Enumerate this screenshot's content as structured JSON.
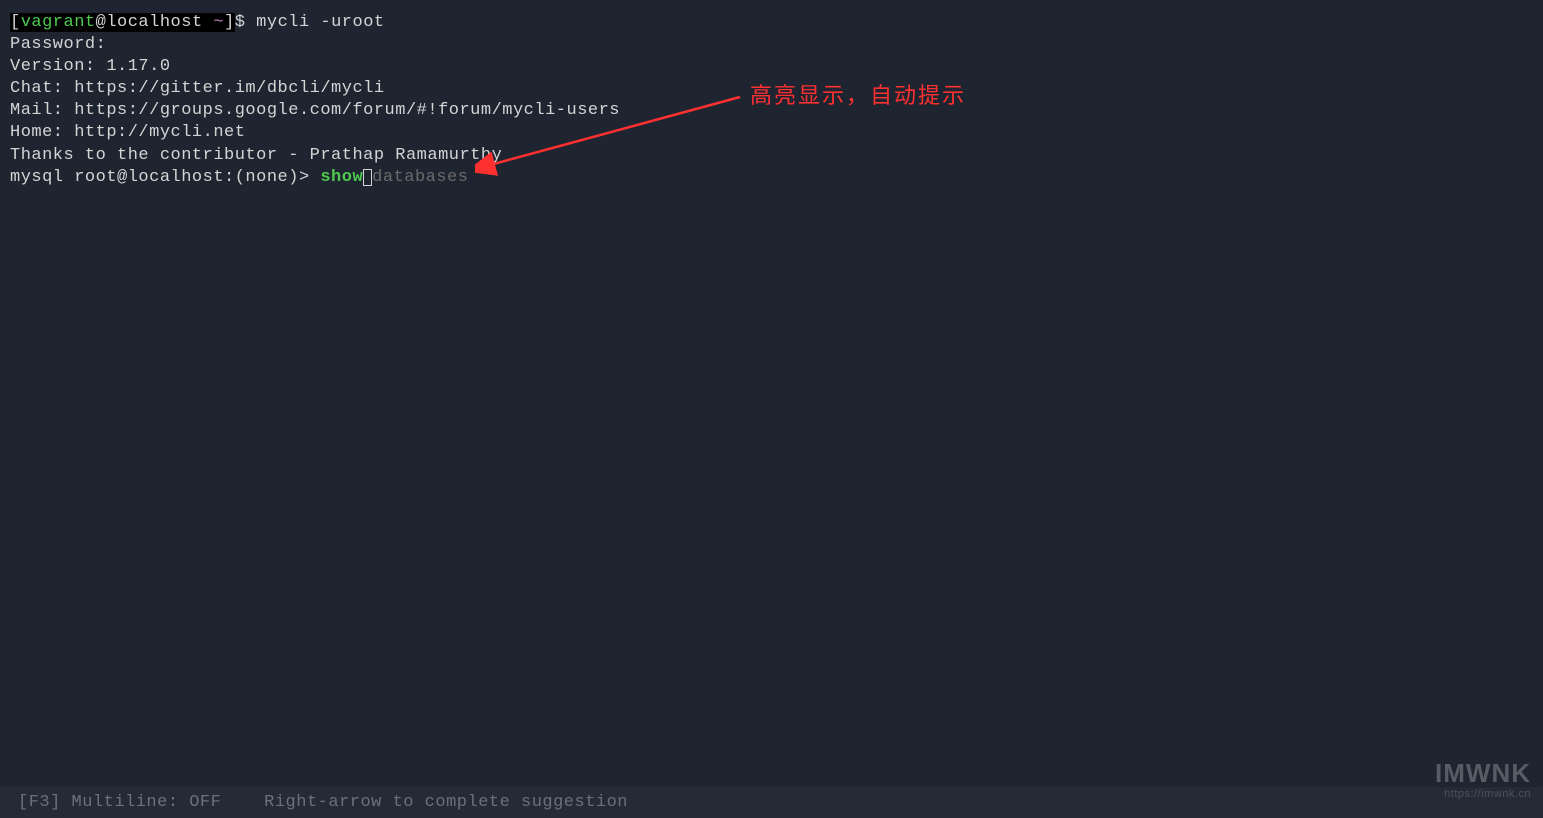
{
  "prompt": {
    "open_bracket": "[",
    "user": "vagrant",
    "at": "@",
    "host": "localhost ",
    "tilde": "~",
    "close_bracket": "]",
    "dollar": "$ ",
    "command": "mycli -uroot"
  },
  "output": {
    "password": "Password:",
    "version": "Version: 1.17.0",
    "chat": "Chat: https://gitter.im/dbcli/mycli",
    "mail": "Mail: https://groups.google.com/forum/#!forum/mycli-users",
    "home": "Home: http://mycli.net",
    "thanks": "Thanks to the contributor - Prathap Ramamurthy"
  },
  "mysql": {
    "prompt": "mysql root@localhost:(none)> ",
    "keyword": "show",
    "suggestion": "databases"
  },
  "annotation": {
    "text": "高亮显示，自动提示"
  },
  "status": {
    "multiline": "[F3] Multiline: OFF",
    "hint": "Right-arrow to complete suggestion"
  },
  "watermark": {
    "title": "IMWNK",
    "url": "https://imwnk.cn"
  }
}
